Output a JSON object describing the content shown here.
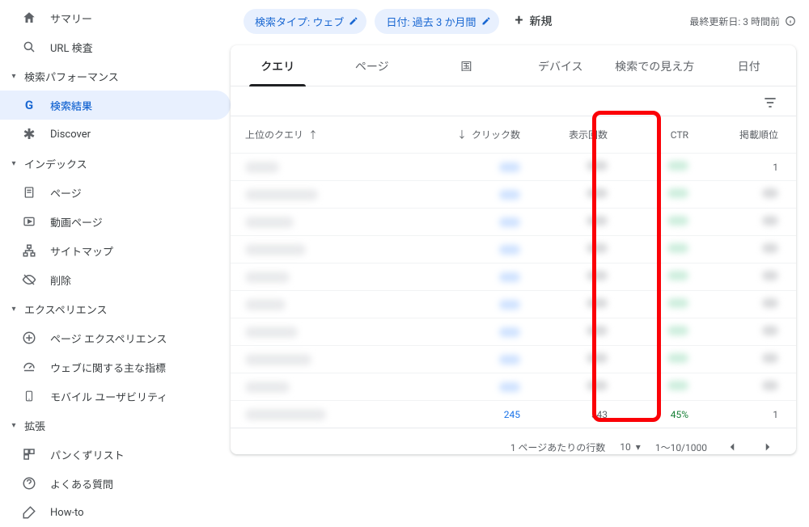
{
  "sidebar": {
    "summary_label": "サマリー",
    "url_inspect_label": "URL 検査",
    "section_perf": "検索パフォーマンス",
    "search_results_label": "検索結果",
    "discover_label": "Discover",
    "section_index": "インデックス",
    "pages_label": "ページ",
    "video_pages_label": "動画ページ",
    "sitemap_label": "サイトマップ",
    "remove_label": "削除",
    "section_experience": "エクスペリエンス",
    "page_exp_label": "ページ エクスペリエンス",
    "cwv_label": "ウェブに関する主な指標",
    "mobile_usability_label": "モバイル ユーザビリティ",
    "section_enhance": "拡張",
    "breadcrumb_label": "パンくずリスト",
    "faq_label": "よくある質問",
    "howto_label": "How-to"
  },
  "topbar": {
    "chip1": "検索タイプ: ウェブ",
    "chip2": "日付: 過去 3 か月間",
    "new_label": "新規",
    "updated_label": "最終更新日: 3 時間前"
  },
  "tabs": {
    "t1": "クエリ",
    "t2": "ページ",
    "t3": "国",
    "t4": "デバイス",
    "t5": "検索での見え方",
    "t6": "日付"
  },
  "table": {
    "head_query": "上位のクエリ",
    "head_clicks": "クリック数",
    "head_impressions": "表示回数",
    "head_ctr": "CTR",
    "head_position": "掲載順位",
    "last_row": {
      "clicks": "245",
      "impressions": "543",
      "ctr": "45%",
      "position": "1"
    },
    "first_row_position": "1"
  },
  "pager": {
    "rows_label": "1 ページあたりの行数",
    "rows_value": "10",
    "range": "1～10/1000"
  }
}
